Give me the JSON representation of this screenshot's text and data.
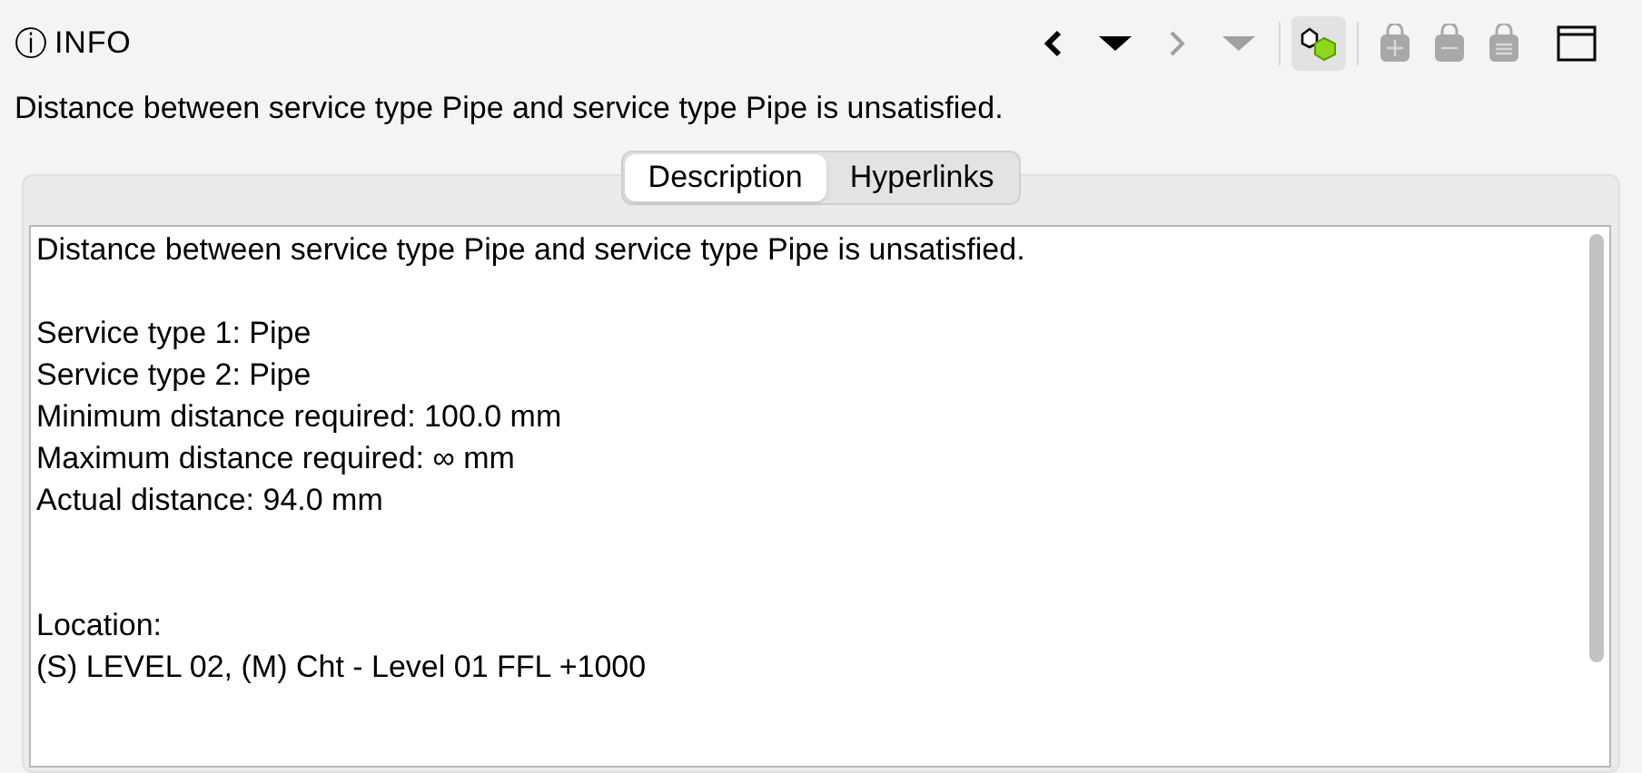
{
  "header": {
    "icon": "ⓘ",
    "title": "INFO"
  },
  "toolbar": [
    {
      "kind": "back",
      "disabled": false
    },
    {
      "kind": "dropdown",
      "disabled": false
    },
    {
      "kind": "forward",
      "disabled": true
    },
    {
      "kind": "dropdown",
      "disabled": true
    },
    {
      "kind": "separator"
    },
    {
      "kind": "toggle",
      "selected": true
    },
    {
      "kind": "separator"
    },
    {
      "kind": "add",
      "disabled": true
    },
    {
      "kind": "remove",
      "disabled": true
    },
    {
      "kind": "equal",
      "disabled": true
    },
    {
      "kind": "maximize",
      "disabled": false
    }
  ],
  "summary": "Distance between service type Pipe and service type Pipe is unsatisfied.",
  "tabs": [
    {
      "label": "Description",
      "selected": true
    },
    {
      "label": "Hyperlinks",
      "selected": false
    }
  ],
  "description": [
    {
      "kind": "paragraph",
      "lines": [
        "Distance between service type Pipe and service type Pipe is unsatisfied."
      ]
    },
    {
      "kind": "paragraph",
      "lines": [
        "Service type 1: Pipe",
        "Service type 2: Pipe",
        "Minimum distance required: 100.0 mm",
        "Maximum distance required: ∞ mm",
        "Actual distance: 94.0 mm"
      ]
    },
    {
      "kind": "section",
      "lines": [
        "Location:",
        "(S) LEVEL 02, (M) Cht - Level 01 FFL +1000"
      ]
    }
  ]
}
